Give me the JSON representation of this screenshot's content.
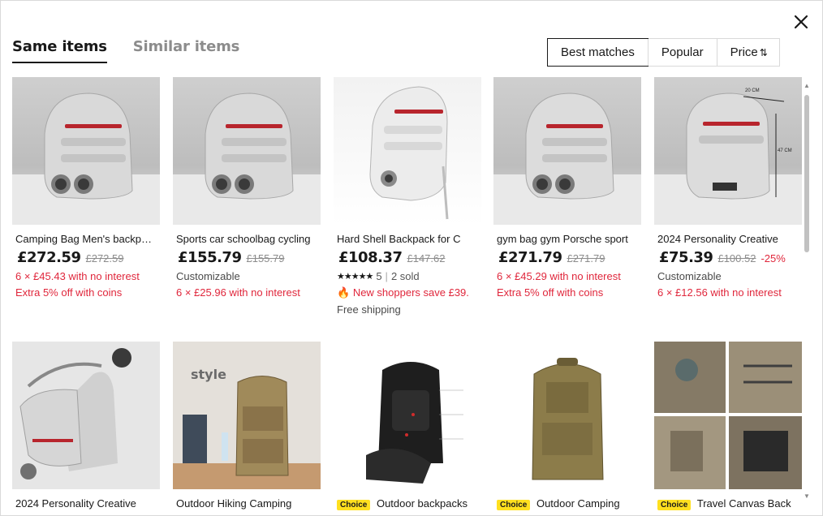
{
  "tabs": [
    {
      "label": "Same items",
      "active": true
    },
    {
      "label": "Similar items",
      "active": false
    }
  ],
  "sort": {
    "best": "Best matches",
    "popular": "Popular",
    "price": "Price",
    "price_icon": "⇅"
  },
  "close_icon": "close-icon",
  "products": [
    {
      "title": "Camping Bag Men's backpack",
      "price": "£272.59",
      "old_price": "£272.59",
      "line1": "6 × £45.43 with no interest",
      "line2": "Extra 5% off with coins"
    },
    {
      "title": "Sports car schoolbag cycling",
      "price": "£155.79",
      "old_price": "£155.79",
      "line1": "Customizable",
      "line2": "6 × £25.96 with no interest"
    },
    {
      "title": "Hard Shell Backpack for C",
      "price": "£108.37",
      "old_price": "£147.62",
      "rating": "5",
      "sold": "2 sold",
      "line1": "New shoppers save £39.",
      "line2": "Free shipping"
    },
    {
      "title": "gym bag gym Porsche sport",
      "price": "£271.79",
      "old_price": "£271.79",
      "line1": "6 × £45.29 with no interest",
      "line2": "Extra 5% off with coins"
    },
    {
      "title": "2024 Personality Creative",
      "price": "£75.39",
      "old_price": "£100.52",
      "discount": "-25%",
      "line1": "Customizable",
      "line2": "6 × £12.56 with no interest"
    },
    {
      "title": "2024 Personality Creative"
    },
    {
      "title": "Outdoor Hiking Camping"
    },
    {
      "badge": "Choice",
      "title": "Outdoor backpacks"
    },
    {
      "badge": "Choice",
      "title": "Outdoor Camping"
    },
    {
      "badge": "Choice",
      "title": "Travel Canvas Back"
    }
  ],
  "image_text": {
    "style_word": "style",
    "dims_w": "20 CM",
    "dims_h": "47 CM"
  },
  "colors": {
    "accent_red": "#e0273c",
    "choice_yellow": "#ffe01f"
  }
}
